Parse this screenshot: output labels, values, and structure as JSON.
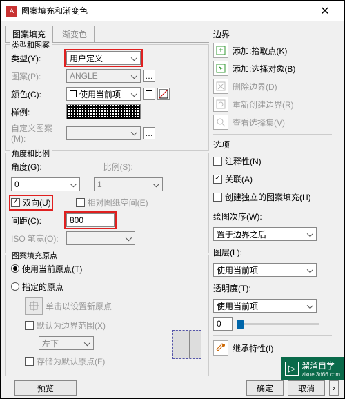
{
  "title": "图案填充和渐变色",
  "tabs": {
    "hatch": "图案填充",
    "gradient": "渐变色"
  },
  "type_pattern": {
    "legend": "类型和图案",
    "type_label": "类型(Y):",
    "type_value": "用户定义",
    "pattern_label": "图案(P):",
    "pattern_value": "ANGLE",
    "color_label": "颜色(C):",
    "color_value": "使用当前项",
    "sample_label": "样例:",
    "custom_label": "自定义图案(M):"
  },
  "angle_scale": {
    "legend": "角度和比例",
    "angle_label": "角度(G):",
    "angle_value": "0",
    "scale_label": "比例(S):",
    "scale_value": "1",
    "double_label": "双向(U)",
    "paperspace_label": "相对图纸空间(E)",
    "spacing_label": "间距(C):",
    "spacing_value": "800",
    "iso_label": "ISO 笔宽(O):"
  },
  "origin": {
    "legend": "图案填充原点",
    "current_label": "使用当前原点(T)",
    "specified_label": "指定的原点",
    "click_label": "单击以设置新原点",
    "default_label": "默认为边界范围(X)",
    "pos_value": "左下",
    "store_label": "存储为默认原点(F)"
  },
  "boundary": {
    "legend": "边界",
    "add_pick": "添加:拾取点(K)",
    "add_select": "添加:选择对象(B)",
    "delete": "删除边界(D)",
    "recreate": "重新创建边界(R)",
    "view": "查看选择集(V)"
  },
  "options": {
    "legend": "选项",
    "annotative": "注释性(N)",
    "associative": "关联(A)",
    "separate": "创建独立的图案填充(H)",
    "draworder_label": "绘图次序(W):",
    "draworder_value": "置于边界之后",
    "layer_label": "图层(L):",
    "layer_value": "使用当前项",
    "transparency_label": "透明度(T):",
    "transparency_value": "使用当前项",
    "transparency_num": "0"
  },
  "inherit": "继承特性(I)",
  "buttons": {
    "preview": "预览",
    "ok": "确定",
    "cancel": "取消"
  },
  "watermark": {
    "brand": "溜溜自学",
    "sub": "zixue.3d66.com"
  }
}
